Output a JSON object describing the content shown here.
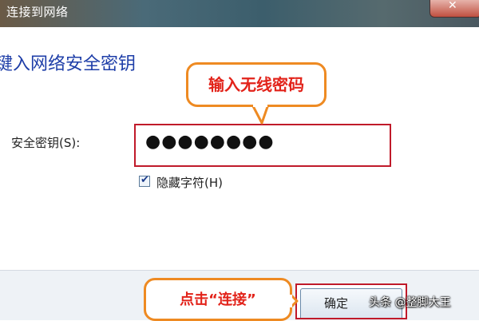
{
  "window": {
    "title": "连接到网络",
    "close_icon": "close-icon"
  },
  "dialog": {
    "heading": "键入网络安全密钥",
    "key_label": "安全密钥(S):",
    "key_value": "●●●●●●●●",
    "hide_chars": {
      "label": "隐藏字符(H)",
      "checked": true
    },
    "confirm_button": "确定"
  },
  "annotations": {
    "top_callout": "输入无线密码",
    "bottom_callout": "点击“连接”",
    "accent_color": "#c01a2a",
    "callout_border_color": "#ee8a22"
  },
  "watermark": "头条 @整脚大王"
}
